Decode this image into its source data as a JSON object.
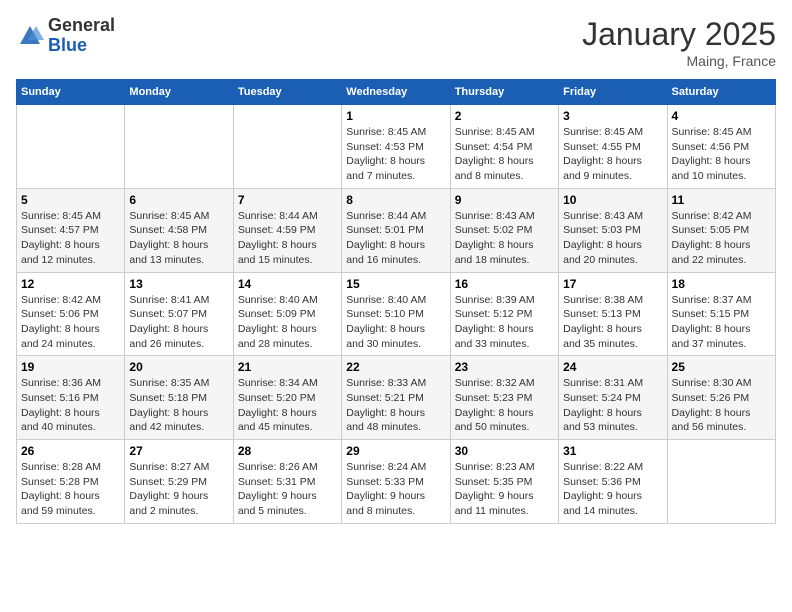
{
  "header": {
    "logo_general": "General",
    "logo_blue": "Blue",
    "month_title": "January 2025",
    "location": "Maing, France"
  },
  "weekdays": [
    "Sunday",
    "Monday",
    "Tuesday",
    "Wednesday",
    "Thursday",
    "Friday",
    "Saturday"
  ],
  "weeks": [
    [
      {
        "day": "",
        "info": ""
      },
      {
        "day": "",
        "info": ""
      },
      {
        "day": "",
        "info": ""
      },
      {
        "day": "1",
        "info": "Sunrise: 8:45 AM\nSunset: 4:53 PM\nDaylight: 8 hours\nand 7 minutes."
      },
      {
        "day": "2",
        "info": "Sunrise: 8:45 AM\nSunset: 4:54 PM\nDaylight: 8 hours\nand 8 minutes."
      },
      {
        "day": "3",
        "info": "Sunrise: 8:45 AM\nSunset: 4:55 PM\nDaylight: 8 hours\nand 9 minutes."
      },
      {
        "day": "4",
        "info": "Sunrise: 8:45 AM\nSunset: 4:56 PM\nDaylight: 8 hours\nand 10 minutes."
      }
    ],
    [
      {
        "day": "5",
        "info": "Sunrise: 8:45 AM\nSunset: 4:57 PM\nDaylight: 8 hours\nand 12 minutes."
      },
      {
        "day": "6",
        "info": "Sunrise: 8:45 AM\nSunset: 4:58 PM\nDaylight: 8 hours\nand 13 minutes."
      },
      {
        "day": "7",
        "info": "Sunrise: 8:44 AM\nSunset: 4:59 PM\nDaylight: 8 hours\nand 15 minutes."
      },
      {
        "day": "8",
        "info": "Sunrise: 8:44 AM\nSunset: 5:01 PM\nDaylight: 8 hours\nand 16 minutes."
      },
      {
        "day": "9",
        "info": "Sunrise: 8:43 AM\nSunset: 5:02 PM\nDaylight: 8 hours\nand 18 minutes."
      },
      {
        "day": "10",
        "info": "Sunrise: 8:43 AM\nSunset: 5:03 PM\nDaylight: 8 hours\nand 20 minutes."
      },
      {
        "day": "11",
        "info": "Sunrise: 8:42 AM\nSunset: 5:05 PM\nDaylight: 8 hours\nand 22 minutes."
      }
    ],
    [
      {
        "day": "12",
        "info": "Sunrise: 8:42 AM\nSunset: 5:06 PM\nDaylight: 8 hours\nand 24 minutes."
      },
      {
        "day": "13",
        "info": "Sunrise: 8:41 AM\nSunset: 5:07 PM\nDaylight: 8 hours\nand 26 minutes."
      },
      {
        "day": "14",
        "info": "Sunrise: 8:40 AM\nSunset: 5:09 PM\nDaylight: 8 hours\nand 28 minutes."
      },
      {
        "day": "15",
        "info": "Sunrise: 8:40 AM\nSunset: 5:10 PM\nDaylight: 8 hours\nand 30 minutes."
      },
      {
        "day": "16",
        "info": "Sunrise: 8:39 AM\nSunset: 5:12 PM\nDaylight: 8 hours\nand 33 minutes."
      },
      {
        "day": "17",
        "info": "Sunrise: 8:38 AM\nSunset: 5:13 PM\nDaylight: 8 hours\nand 35 minutes."
      },
      {
        "day": "18",
        "info": "Sunrise: 8:37 AM\nSunset: 5:15 PM\nDaylight: 8 hours\nand 37 minutes."
      }
    ],
    [
      {
        "day": "19",
        "info": "Sunrise: 8:36 AM\nSunset: 5:16 PM\nDaylight: 8 hours\nand 40 minutes."
      },
      {
        "day": "20",
        "info": "Sunrise: 8:35 AM\nSunset: 5:18 PM\nDaylight: 8 hours\nand 42 minutes."
      },
      {
        "day": "21",
        "info": "Sunrise: 8:34 AM\nSunset: 5:20 PM\nDaylight: 8 hours\nand 45 minutes."
      },
      {
        "day": "22",
        "info": "Sunrise: 8:33 AM\nSunset: 5:21 PM\nDaylight: 8 hours\nand 48 minutes."
      },
      {
        "day": "23",
        "info": "Sunrise: 8:32 AM\nSunset: 5:23 PM\nDaylight: 8 hours\nand 50 minutes."
      },
      {
        "day": "24",
        "info": "Sunrise: 8:31 AM\nSunset: 5:24 PM\nDaylight: 8 hours\nand 53 minutes."
      },
      {
        "day": "25",
        "info": "Sunrise: 8:30 AM\nSunset: 5:26 PM\nDaylight: 8 hours\nand 56 minutes."
      }
    ],
    [
      {
        "day": "26",
        "info": "Sunrise: 8:28 AM\nSunset: 5:28 PM\nDaylight: 8 hours\nand 59 minutes."
      },
      {
        "day": "27",
        "info": "Sunrise: 8:27 AM\nSunset: 5:29 PM\nDaylight: 9 hours\nand 2 minutes."
      },
      {
        "day": "28",
        "info": "Sunrise: 8:26 AM\nSunset: 5:31 PM\nDaylight: 9 hours\nand 5 minutes."
      },
      {
        "day": "29",
        "info": "Sunrise: 8:24 AM\nSunset: 5:33 PM\nDaylight: 9 hours\nand 8 minutes."
      },
      {
        "day": "30",
        "info": "Sunrise: 8:23 AM\nSunset: 5:35 PM\nDaylight: 9 hours\nand 11 minutes."
      },
      {
        "day": "31",
        "info": "Sunrise: 8:22 AM\nSunset: 5:36 PM\nDaylight: 9 hours\nand 14 minutes."
      },
      {
        "day": "",
        "info": ""
      }
    ]
  ]
}
